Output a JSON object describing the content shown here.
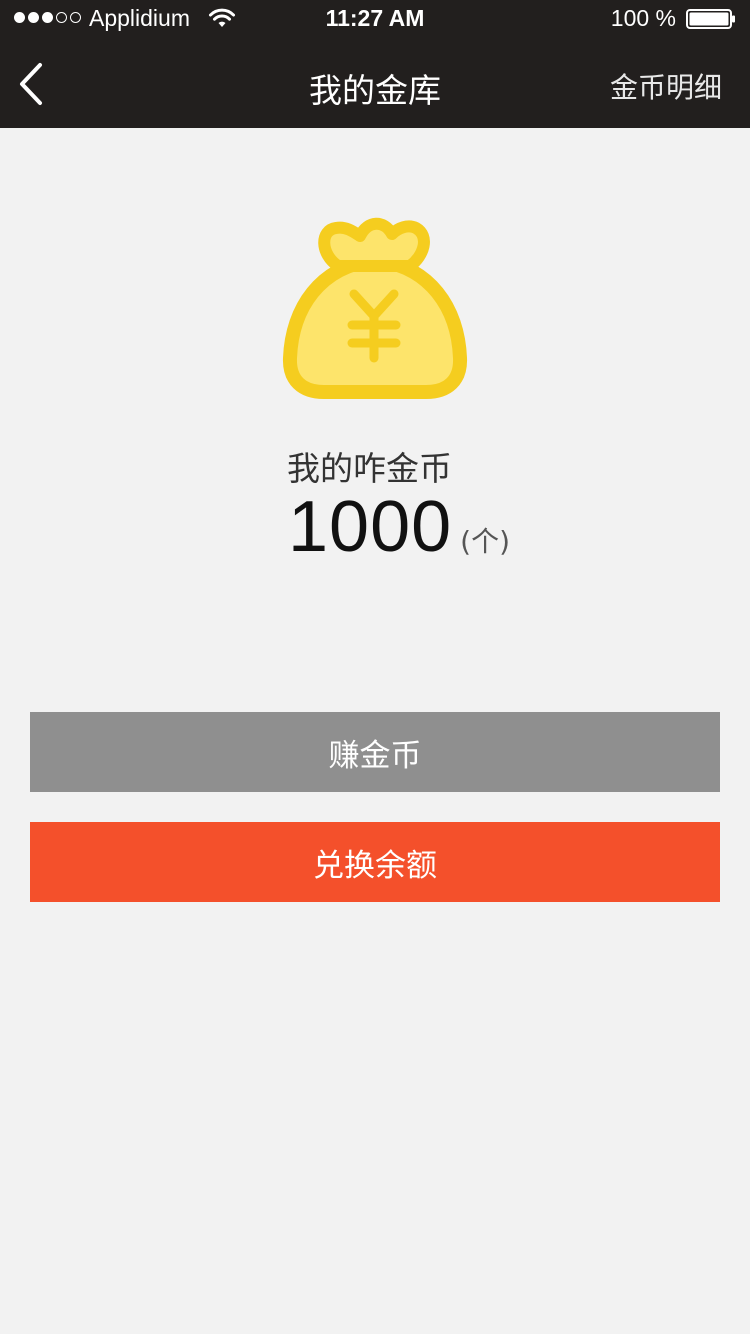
{
  "status_bar": {
    "carrier": "Applidium",
    "time": "11:27 AM",
    "battery": "100 %",
    "signal_bars_filled": 3,
    "signal_bars_total": 5
  },
  "nav": {
    "title": "我的金库",
    "right_link": "金币明细",
    "back_icon": "chevron-left-icon"
  },
  "wallet": {
    "icon": "money-bag-yen-icon",
    "label": "我的咋金币",
    "amount": "1000",
    "unit": "(个)"
  },
  "buttons": {
    "earn_label": "赚金币",
    "exchange_label": "兑换余额"
  },
  "colors": {
    "header_bg": "#221f1e",
    "page_bg": "#f2f2f2",
    "earn_button": "#8f8f8f",
    "exchange_button": "#f4502b",
    "bag_outline": "#f5cd1f",
    "bag_fill": "#fde46b"
  }
}
